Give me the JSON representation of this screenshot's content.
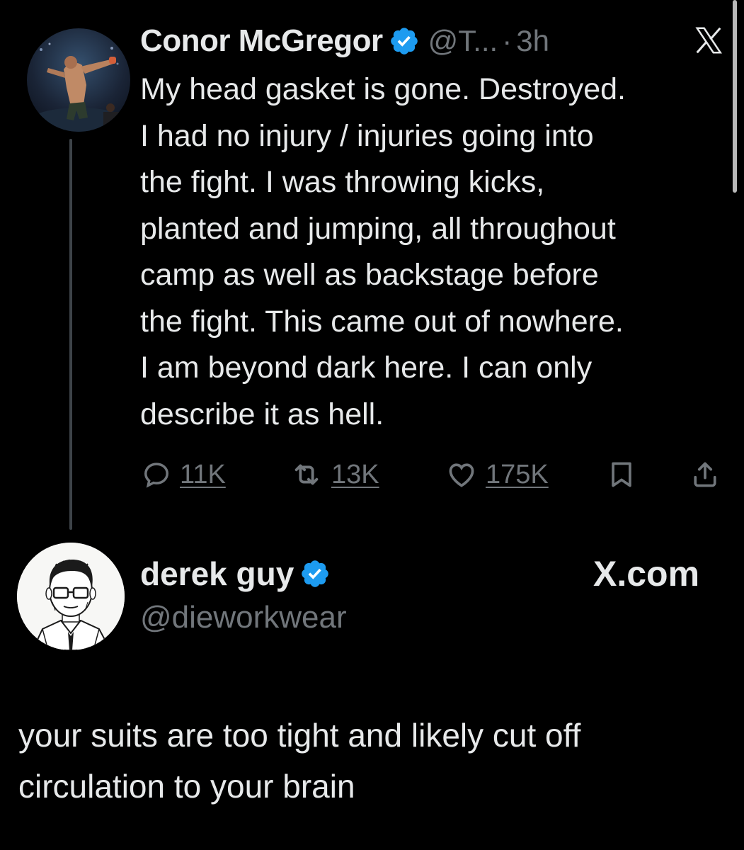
{
  "reply_tweet": {
    "author_name": "Conor McGregor",
    "handle": "@T...",
    "separator": "·",
    "time": "3h",
    "verified": true,
    "avatar_icon": "fighter-photo-avatar",
    "body": "My head gasket is gone. Destroyed.\nI had no injury / injuries going into\nthe fight. I was throwing kicks,\nplanted and jumping, all throughout\ncamp as well as backstage before\nthe fight. This came out of nowhere.\nI am beyond dark here. I can only\ndescribe it as hell.",
    "actions": {
      "replies": "11K",
      "reposts": "13K",
      "likes": "175K"
    }
  },
  "quote_tweet": {
    "author_name": "derek guy",
    "handle": "@dieworkwear",
    "verified": true,
    "avatar_icon": "sketch-portrait-avatar",
    "brand": "X.com",
    "body": "your suits are too tight and likely cut off\ncirculation to your brain"
  },
  "colors": {
    "background": "#000000",
    "text_primary": "#e7e9ea",
    "text_secondary": "#71767b",
    "verified_blue": "#1d9bf0",
    "thread_line": "#3d4348"
  }
}
